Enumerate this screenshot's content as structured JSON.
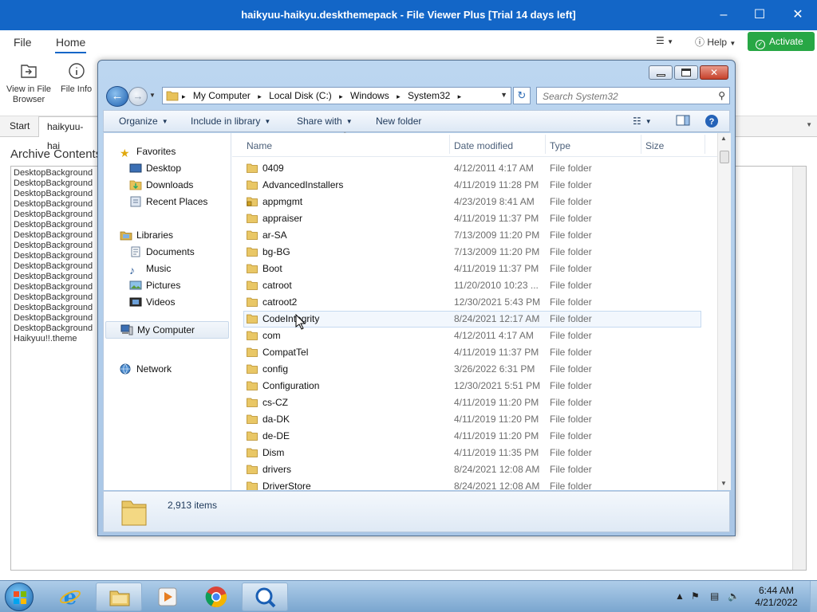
{
  "fvp": {
    "title": "haikyuu-haikyu.deskthemepack - File Viewer Plus [Trial 14 days left]",
    "menu": {
      "file": "File",
      "home": "Home",
      "help": "Help",
      "activate": "Activate"
    },
    "ribbon": {
      "view_in_browser_1": "View in File",
      "view_in_browser_2": "Browser",
      "file_info": "File Info"
    },
    "tabs": {
      "start": "Start",
      "file_tab": "haikyuu-hai"
    },
    "archive_heading": "Archive Contents",
    "archive_items": [
      "DesktopBackground",
      "DesktopBackground",
      "DesktopBackground",
      "DesktopBackground",
      "DesktopBackground",
      "DesktopBackground",
      "DesktopBackground",
      "DesktopBackground",
      "DesktopBackground",
      "DesktopBackground",
      "DesktopBackground",
      "DesktopBackground",
      "DesktopBackground",
      "DesktopBackground",
      "DesktopBackground",
      "DesktopBackground",
      "Haikyuu!!.theme"
    ]
  },
  "explorer": {
    "breadcrumbs": [
      "My Computer",
      "Local Disk (C:)",
      "Windows",
      "System32"
    ],
    "search_placeholder": "Search System32",
    "commands": {
      "organize": "Organize",
      "include": "Include in library",
      "share": "Share with",
      "new_folder": "New folder"
    },
    "nav": {
      "favorites": "Favorites",
      "desktop": "Desktop",
      "downloads": "Downloads",
      "recent": "Recent Places",
      "libraries": "Libraries",
      "documents": "Documents",
      "music": "Music",
      "pictures": "Pictures",
      "videos": "Videos",
      "computer": "My Computer",
      "network": "Network"
    },
    "columns": {
      "name": "Name",
      "date": "Date modified",
      "type": "Type",
      "size": "Size"
    },
    "files": [
      {
        "name": "0409",
        "date": "4/12/2011 4:17 AM",
        "type": "File folder"
      },
      {
        "name": "AdvancedInstallers",
        "date": "4/11/2019 11:28 PM",
        "type": "File folder"
      },
      {
        "name": "appmgmt",
        "date": "4/23/2019 8:41 AM",
        "type": "File folder",
        "locked": true
      },
      {
        "name": "appraiser",
        "date": "4/11/2019 11:37 PM",
        "type": "File folder"
      },
      {
        "name": "ar-SA",
        "date": "7/13/2009 11:20 PM",
        "type": "File folder"
      },
      {
        "name": "bg-BG",
        "date": "7/13/2009 11:20 PM",
        "type": "File folder"
      },
      {
        "name": "Boot",
        "date": "4/11/2019 11:37 PM",
        "type": "File folder"
      },
      {
        "name": "catroot",
        "date": "11/20/2010 10:23 ...",
        "type": "File folder"
      },
      {
        "name": "catroot2",
        "date": "12/30/2021 5:43 PM",
        "type": "File folder"
      },
      {
        "name": "CodeIntegrity",
        "date": "8/24/2021 12:17 AM",
        "type": "File folder",
        "hover": true
      },
      {
        "name": "com",
        "date": "4/12/2011 4:17 AM",
        "type": "File folder"
      },
      {
        "name": "CompatTel",
        "date": "4/11/2019 11:37 PM",
        "type": "File folder"
      },
      {
        "name": "config",
        "date": "3/26/2022 6:31 PM",
        "type": "File folder"
      },
      {
        "name": "Configuration",
        "date": "12/30/2021 5:51 PM",
        "type": "File folder"
      },
      {
        "name": "cs-CZ",
        "date": "4/11/2019 11:20 PM",
        "type": "File folder"
      },
      {
        "name": "da-DK",
        "date": "4/11/2019 11:20 PM",
        "type": "File folder"
      },
      {
        "name": "de-DE",
        "date": "4/11/2019 11:20 PM",
        "type": "File folder"
      },
      {
        "name": "Dism",
        "date": "4/11/2019 11:35 PM",
        "type": "File folder"
      },
      {
        "name": "drivers",
        "date": "8/24/2021 12:08 AM",
        "type": "File folder"
      },
      {
        "name": "DriverStore",
        "date": "8/24/2021 12:08 AM",
        "type": "File folder"
      }
    ],
    "item_count": "2,913 items"
  },
  "taskbar": {
    "time": "6:44 AM",
    "date": "4/21/2022"
  }
}
